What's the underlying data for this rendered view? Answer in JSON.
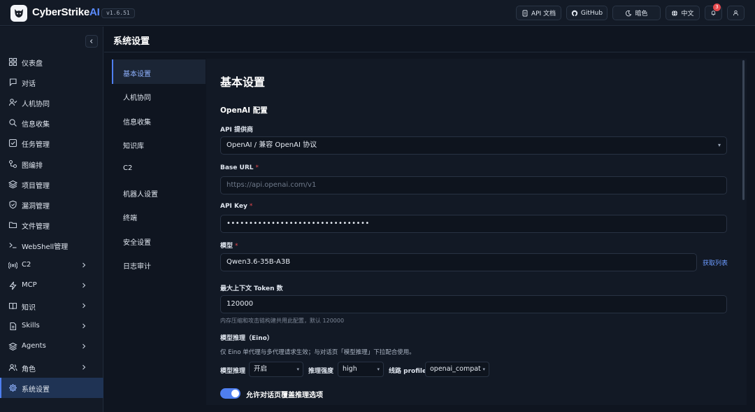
{
  "header": {
    "brand_main": "CyberStrike",
    "brand_ai": "AI",
    "version": "v1.6.51",
    "api_docs": "API 文档",
    "github": "GitHub",
    "theme": "暗色",
    "language": "中文",
    "notifications_count": "3"
  },
  "sidebar": {
    "items": [
      {
        "label": "仪表盘",
        "icon": "dashboard-icon"
      },
      {
        "label": "对话",
        "icon": "chat-icon"
      },
      {
        "label": "人机协同",
        "icon": "user-check-icon"
      },
      {
        "label": "信息收集",
        "icon": "search-icon"
      },
      {
        "label": "任务管理",
        "icon": "task-icon"
      },
      {
        "label": "图编排",
        "icon": "workflow-icon"
      },
      {
        "label": "项目管理",
        "icon": "layers-icon"
      },
      {
        "label": "漏洞管理",
        "icon": "shield-icon"
      },
      {
        "label": "文件管理",
        "icon": "folder-icon"
      },
      {
        "label": "WebShell管理",
        "icon": "terminal-icon"
      },
      {
        "label": "C2",
        "icon": "broadcast-icon"
      },
      {
        "label": "MCP",
        "icon": "bolt-icon"
      },
      {
        "label": "知识",
        "icon": "book-icon"
      },
      {
        "label": "Skills",
        "icon": "file-icon"
      },
      {
        "label": "Agents",
        "icon": "stack-icon"
      },
      {
        "label": "角色",
        "icon": "users-icon"
      },
      {
        "label": "系统设置",
        "icon": "gear-icon"
      }
    ]
  },
  "page": {
    "title": "系统设置"
  },
  "subnav": {
    "items": [
      "基本设置",
      "人机协同",
      "信息收集",
      "知识库",
      "C2",
      "机器人设置",
      "终端",
      "安全设置",
      "日志审计"
    ]
  },
  "settings": {
    "heading": "基本设置",
    "section": "OpenAI 配置",
    "provider_label": "API 提供商",
    "provider_value": "OpenAI / 兼容 OpenAI 协议",
    "base_url_label": "Base URL",
    "base_url_placeholder": "https://api.openai.com/v1",
    "api_key_label": "API Key",
    "api_key_value": "••••••••••••••••••••••••••••••••",
    "model_label": "模型",
    "model_value": "Qwen3.6-35B-A3B",
    "fetch_list": "获取列表",
    "max_tokens_label": "最大上下文 Token 数",
    "max_tokens_value": "120000",
    "max_tokens_hint": "内存压缩和攻击链构建共用此配置，默认 120000",
    "reasoning_title": "模型推理（Eino）",
    "reasoning_desc": "仅 Eino 单代理与多代理请求生效；与对话页「模型推理」下拉配合使用。",
    "reasoning_label": "模型推理",
    "reasoning_value": "开启",
    "strength_label": "推理强度",
    "strength_value": "high",
    "profile_label": "线路 profile",
    "profile_value": "openai_compat",
    "allow_override_label": "允许对话页覆盖推理选项",
    "allow_override_on": true
  }
}
